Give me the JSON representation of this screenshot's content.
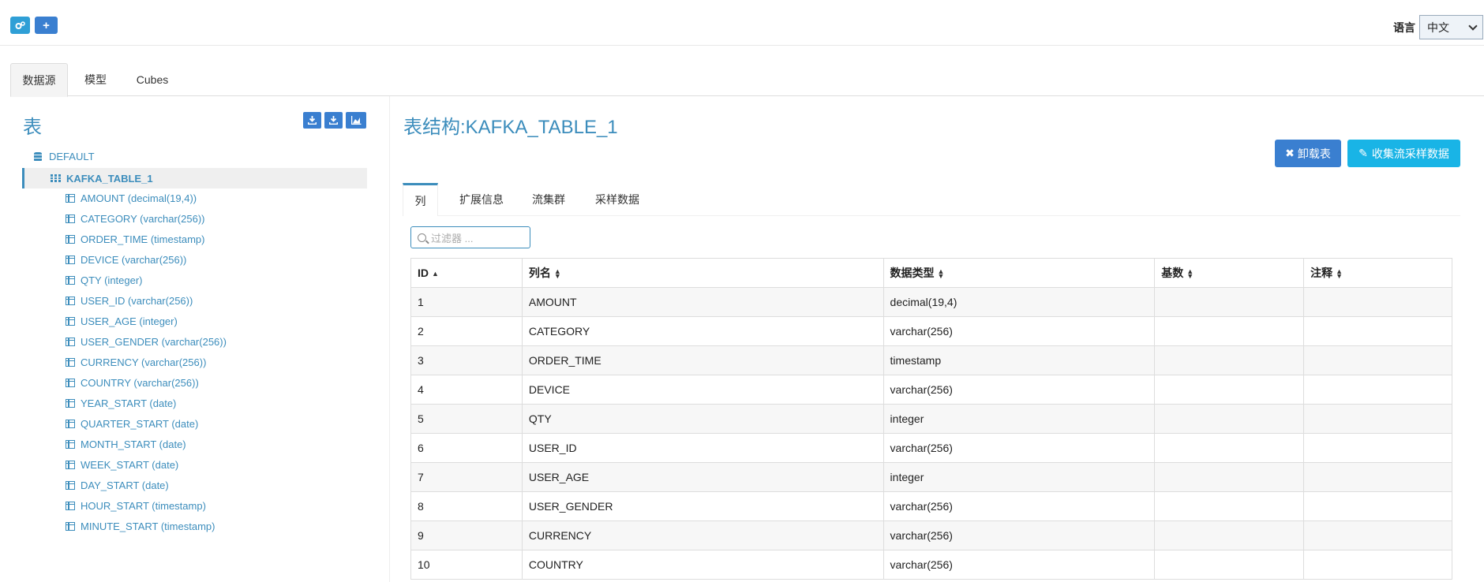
{
  "topbar": {
    "settings_icon": "cogs-icon",
    "add_icon": "plus-icon",
    "language_label": "语言",
    "language_selected": "中文"
  },
  "main_tabs": [
    {
      "label": "数据源",
      "active": true
    },
    {
      "label": "模型",
      "active": false
    },
    {
      "label": "Cubes",
      "active": false
    }
  ],
  "left": {
    "title": "表",
    "buttons": [
      "download-icon",
      "download-icon",
      "area-chart-icon"
    ],
    "database": "DEFAULT",
    "table": "KAFKA_TABLE_1",
    "columns": [
      "AMOUNT (decimal(19,4))",
      "CATEGORY (varchar(256))",
      "ORDER_TIME (timestamp)",
      "DEVICE (varchar(256))",
      "QTY (integer)",
      "USER_ID (varchar(256))",
      "USER_AGE (integer)",
      "USER_GENDER (varchar(256))",
      "CURRENCY (varchar(256))",
      "COUNTRY (varchar(256))",
      "YEAR_START (date)",
      "QUARTER_START (date)",
      "MONTH_START (date)",
      "WEEK_START (date)",
      "DAY_START (date)",
      "HOUR_START (timestamp)",
      "MINUTE_START (timestamp)"
    ]
  },
  "right": {
    "title": "表结构:KAFKA_TABLE_1",
    "unload_label": "卸载表",
    "sample_label": "收集流采样数据",
    "sub_tabs": [
      "列",
      "扩展信息",
      "流集群",
      "采样数据"
    ],
    "filter_placeholder": "过滤器 ...",
    "table": {
      "headers": [
        "ID",
        "列名",
        "数据类型",
        "基数",
        "注释"
      ],
      "rows": [
        [
          "1",
          "AMOUNT",
          "decimal(19,4)",
          "",
          ""
        ],
        [
          "2",
          "CATEGORY",
          "varchar(256)",
          "",
          ""
        ],
        [
          "3",
          "ORDER_TIME",
          "timestamp",
          "",
          ""
        ],
        [
          "4",
          "DEVICE",
          "varchar(256)",
          "",
          ""
        ],
        [
          "5",
          "QTY",
          "integer",
          "",
          ""
        ],
        [
          "6",
          "USER_ID",
          "varchar(256)",
          "",
          ""
        ],
        [
          "7",
          "USER_AGE",
          "integer",
          "",
          ""
        ],
        [
          "8",
          "USER_GENDER",
          "varchar(256)",
          "",
          ""
        ],
        [
          "9",
          "CURRENCY",
          "varchar(256)",
          "",
          ""
        ],
        [
          "10",
          "COUNTRY",
          "varchar(256)",
          "",
          ""
        ]
      ]
    }
  },
  "colors": {
    "accent": "#3c8dbc",
    "button_blue": "#3a7fd0",
    "button_cyan": "#19b4e6"
  }
}
